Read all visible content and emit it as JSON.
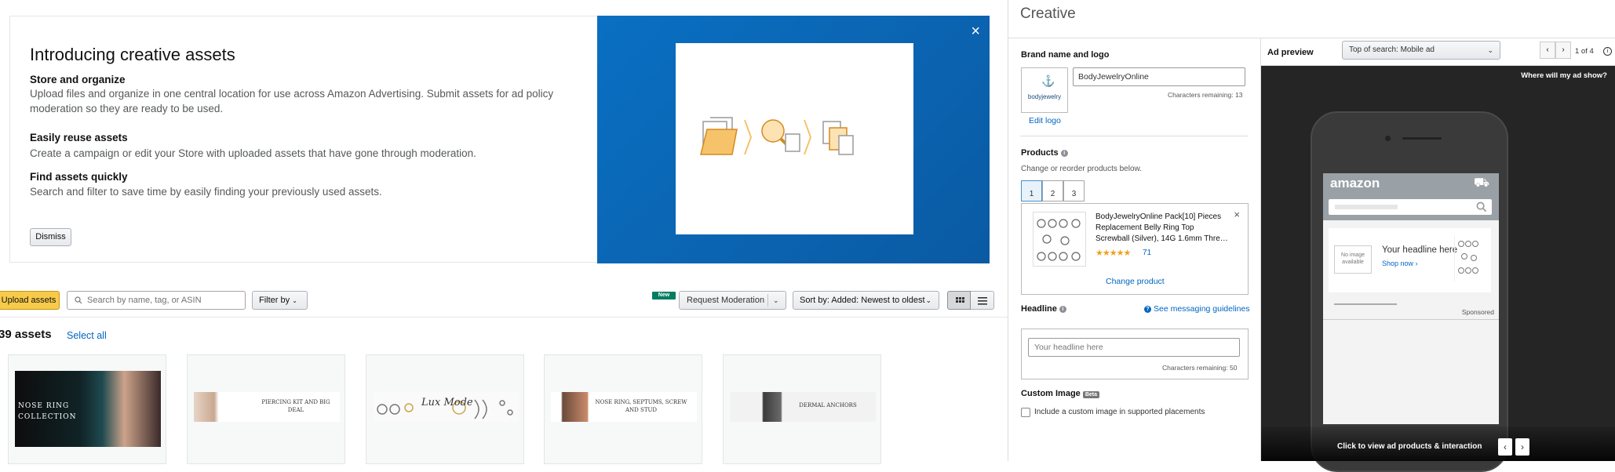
{
  "intro": {
    "title": "Introducing creative assets",
    "features": [
      {
        "heading": "Store and organize",
        "text": "Upload files and organize in one central location for use across Amazon Advertising. Submit assets for ad policy moderation so they are ready to be used."
      },
      {
        "heading": "Easily reuse assets",
        "text": "Create a campaign or edit your Store with uploaded assets that have gone through moderation."
      },
      {
        "heading": "Find assets quickly",
        "text": "Search and filter to save time by easily finding your previously used assets."
      }
    ],
    "dismiss_label": "Dismiss",
    "close_icon": "×"
  },
  "toolbar": {
    "upload_label": "Upload assets",
    "search_placeholder": "Search by name, tag, or ASIN",
    "filter_label": "Filter by",
    "new_badge": "New ",
    "request_moderation_label": "Request Moderation",
    "sort_label": "Sort by: Added: Newest to oldest"
  },
  "assets": {
    "count_label": "39 assets",
    "select_all_label": "Select all",
    "cards": [
      {
        "text": "NOSE RING COLLECTION"
      },
      {
        "text": "PIERCING KIT AND BIG DEAL"
      },
      {
        "text": "Lux Mode"
      },
      {
        "text": "NOSE RING, SEPTUMS, SCREW AND STUD"
      },
      {
        "text": "DERMAL ANCHORS"
      }
    ]
  },
  "creative": {
    "title": "Creative",
    "brand_section_label": "Brand name and logo",
    "brand_name_value": "BodyJewelryOnline",
    "brand_chars_remaining": "Characters remaining: 13",
    "edit_logo_label": "Edit logo",
    "logo_text": "bodyjewelry",
    "products_label": "Products",
    "products_hint": "Change or reorder products below.",
    "product_tabs": [
      "1",
      "2",
      "3"
    ],
    "product_title": "BodyJewelryOnline Pack[10] Pieces Replacement Belly Ring Top Screwball (Silver), 14G 1.6mm Thre…",
    "product_rating_count": "71",
    "product_remove_icon": "×",
    "change_product_label": "Change product",
    "headline_label": "Headline",
    "messaging_guidelines_label": "See messaging guidelines",
    "headline_placeholder": "Your headline here",
    "headline_chars_remaining": "Characters remaining: 50",
    "custom_image_label": "Custom Image",
    "beta_badge": "Beta",
    "custom_image_checkbox_label": "Include a custom image in supported placements"
  },
  "preview": {
    "label": "Ad preview",
    "placement_value": "Top of search: Mobile ad",
    "page_indicator": "1 of 4",
    "where_label": "Where will my ad show?",
    "amazon_logo": "amazon",
    "no_image_text": "No image available",
    "headline_text": "Your headline here",
    "shop_now": "Shop now ›",
    "sponsored": "Sponsored",
    "bottom_bar_text": "Click to view ad products & interaction"
  },
  "colors": {
    "accent_blue": "#0b63b0",
    "upload_yellow": "#f7ca4a",
    "link": "#0066c0",
    "badge_green": "#067d62",
    "star": "#f0a11d"
  }
}
